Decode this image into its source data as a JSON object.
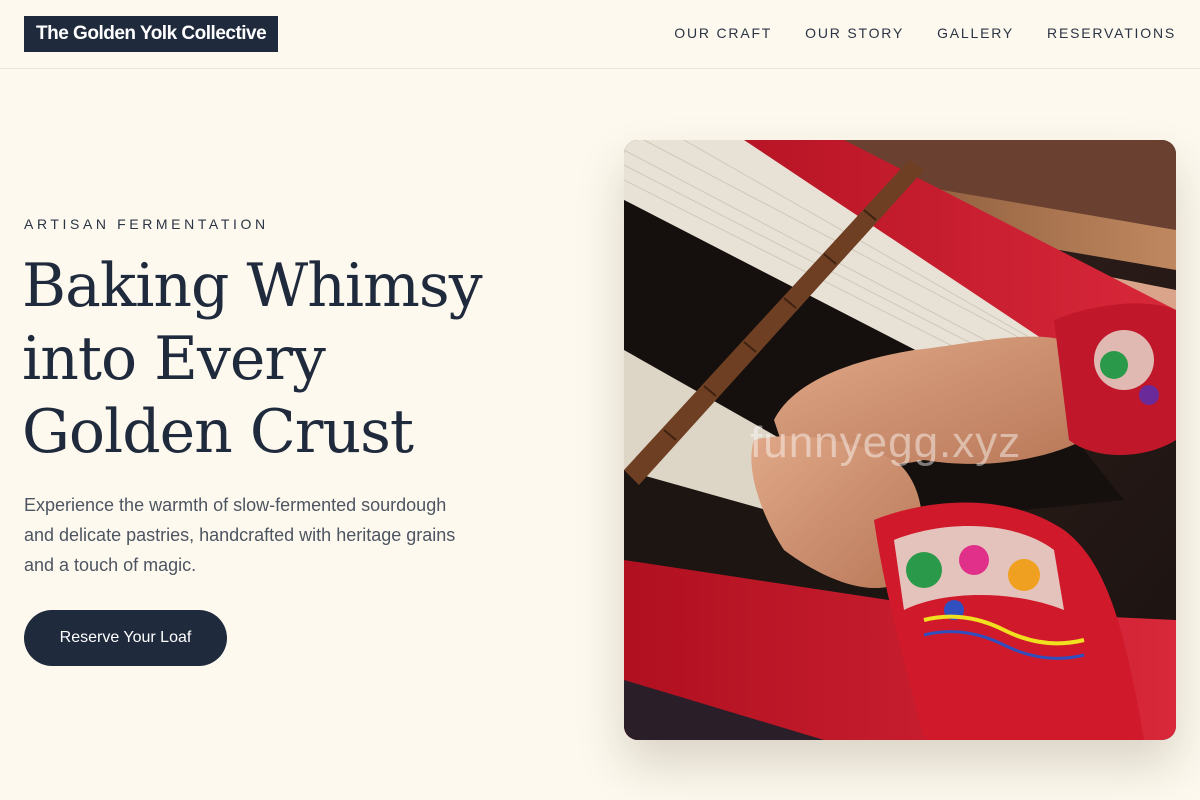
{
  "header": {
    "logo": "The Golden Yolk Collective",
    "nav": [
      "OUR CRAFT",
      "OUR STORY",
      "GALLERY",
      "RESERVATIONS"
    ]
  },
  "hero": {
    "eyebrow": "ARTISAN FERMENTATION",
    "headline_lines": [
      "Baking Whimsy",
      "into Every",
      "Golden Crust"
    ],
    "description": "Experience the warmth of slow-fermented sourdough and delicate pastries, handcrafted with heritage grains and a touch of magic.",
    "cta": "Reserve Your Loaf",
    "image_watermark": "funnyegg.xyz"
  },
  "colors": {
    "background": "#fdf9ee",
    "primary": "#1f2a3d",
    "text_muted": "#4d5562",
    "image_red": "#c8182a"
  }
}
